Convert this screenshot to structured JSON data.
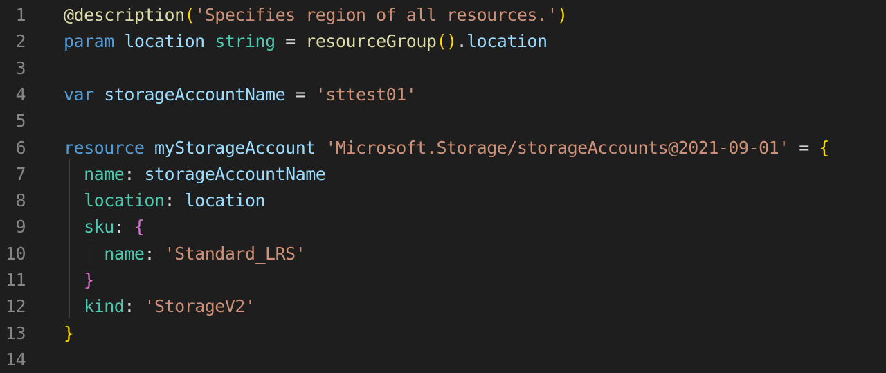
{
  "editor": {
    "lines": [
      {
        "num": "1",
        "tokens": [
          {
            "t": "@description",
            "c": "deco"
          },
          {
            "t": "(",
            "c": "paren"
          },
          {
            "t": "'Specifies region of all resources.'",
            "c": "str"
          },
          {
            "t": ")",
            "c": "paren"
          }
        ]
      },
      {
        "num": "2",
        "tokens": [
          {
            "t": "param",
            "c": "kw"
          },
          {
            "t": " ",
            "c": "plain"
          },
          {
            "t": "location",
            "c": "var"
          },
          {
            "t": " ",
            "c": "plain"
          },
          {
            "t": "string",
            "c": "type"
          },
          {
            "t": " = ",
            "c": "plain"
          },
          {
            "t": "resourceGroup",
            "c": "fn"
          },
          {
            "t": "()",
            "c": "paren"
          },
          {
            "t": ".",
            "c": "plain"
          },
          {
            "t": "location",
            "c": "var"
          }
        ]
      },
      {
        "num": "3",
        "tokens": []
      },
      {
        "num": "4",
        "tokens": [
          {
            "t": "var",
            "c": "kw"
          },
          {
            "t": " ",
            "c": "plain"
          },
          {
            "t": "storageAccountName",
            "c": "var"
          },
          {
            "t": " = ",
            "c": "plain"
          },
          {
            "t": "'sttest01'",
            "c": "str"
          }
        ]
      },
      {
        "num": "5",
        "tokens": []
      },
      {
        "num": "6",
        "tokens": [
          {
            "t": "resource",
            "c": "kw"
          },
          {
            "t": " ",
            "c": "plain"
          },
          {
            "t": "myStorageAccount",
            "c": "var"
          },
          {
            "t": " ",
            "c": "plain"
          },
          {
            "t": "'Microsoft.Storage/storageAccounts@2021-09-01'",
            "c": "str"
          },
          {
            "t": " = ",
            "c": "plain"
          },
          {
            "t": "{",
            "c": "brace1"
          }
        ]
      },
      {
        "num": "7",
        "tokens": [
          {
            "t": "  ",
            "c": "plain"
          },
          {
            "t": "name",
            "c": "prop"
          },
          {
            "t": ": ",
            "c": "plain"
          },
          {
            "t": "storageAccountName",
            "c": "var"
          }
        ]
      },
      {
        "num": "8",
        "tokens": [
          {
            "t": "  ",
            "c": "plain"
          },
          {
            "t": "location",
            "c": "prop"
          },
          {
            "t": ": ",
            "c": "plain"
          },
          {
            "t": "location",
            "c": "var"
          }
        ]
      },
      {
        "num": "9",
        "tokens": [
          {
            "t": "  ",
            "c": "plain"
          },
          {
            "t": "sku",
            "c": "prop"
          },
          {
            "t": ": ",
            "c": "plain"
          },
          {
            "t": "{",
            "c": "brace2"
          }
        ]
      },
      {
        "num": "10",
        "tokens": [
          {
            "t": "    ",
            "c": "plain"
          },
          {
            "t": "name",
            "c": "prop"
          },
          {
            "t": ": ",
            "c": "plain"
          },
          {
            "t": "'Standard_LRS'",
            "c": "str"
          }
        ]
      },
      {
        "num": "11",
        "tokens": [
          {
            "t": "  ",
            "c": "plain"
          },
          {
            "t": "}",
            "c": "brace2"
          }
        ]
      },
      {
        "num": "12",
        "tokens": [
          {
            "t": "  ",
            "c": "plain"
          },
          {
            "t": "kind",
            "c": "prop"
          },
          {
            "t": ": ",
            "c": "plain"
          },
          {
            "t": "'StorageV2'",
            "c": "str"
          }
        ]
      },
      {
        "num": "13",
        "tokens": [
          {
            "t": "}",
            "c": "brace1"
          }
        ]
      },
      {
        "num": "14",
        "tokens": []
      }
    ]
  },
  "colors": {
    "background": "#1e1e1e",
    "line_number": "#858585",
    "keyword": "#569cd6",
    "variable": "#9cdcfe",
    "string": "#ce9178",
    "type": "#4ec9b0",
    "function": "#dcdcaa",
    "bracket_level1": "#ffd700",
    "bracket_level2": "#da70d6"
  }
}
